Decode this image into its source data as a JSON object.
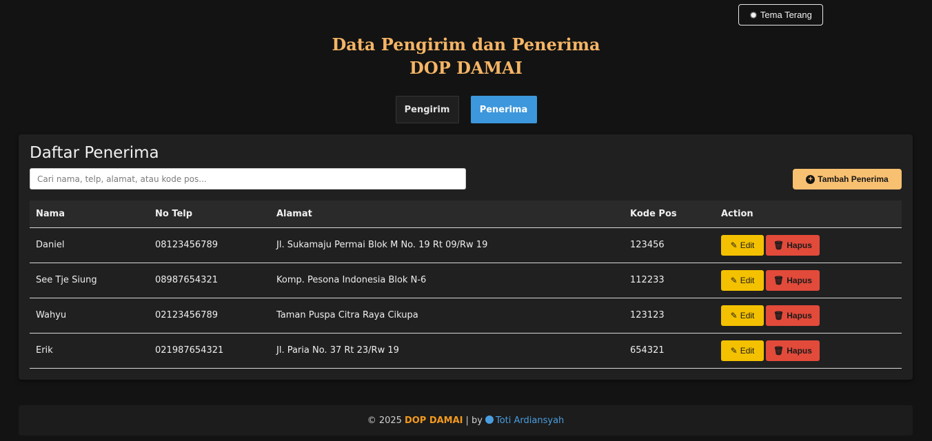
{
  "theme_toggle": {
    "label": "Tema Terang",
    "icon": "gear-icon"
  },
  "header": {
    "title_line1": "Data Pengirim dan Penerima",
    "title_line2": "DOP DAMAI"
  },
  "tabs": [
    {
      "label": "Pengirim",
      "active": false
    },
    {
      "label": "Penerima",
      "active": true
    }
  ],
  "card": {
    "title": "Daftar Penerima",
    "search_placeholder": "Cari nama, telp, alamat, atau kode pos...",
    "add_button": "Tambah Penerima"
  },
  "table": {
    "headers": [
      "Nama",
      "No Telp",
      "Alamat",
      "Kode Pos",
      "Action"
    ],
    "rows": [
      {
        "nama": "Daniel",
        "telp": "08123456789",
        "alamat": "Jl. Sukamaju Permai Blok M No. 19 Rt 09/Rw 19",
        "kode_pos": "123456"
      },
      {
        "nama": "See Tje Siung",
        "telp": "08987654321",
        "alamat": "Komp. Pesona Indonesia Blok N-6",
        "kode_pos": "112233"
      },
      {
        "nama": "Wahyu",
        "telp": "02123456789",
        "alamat": "Taman Puspa Citra Raya Cikupa",
        "kode_pos": "123123"
      },
      {
        "nama": "Erik",
        "telp": "021987654321",
        "alamat": "Jl. Paria No. 37 Rt 23/Rw 19",
        "kode_pos": "654321"
      }
    ],
    "edit_label": "Edit",
    "delete_label": "Hapus"
  },
  "footer": {
    "copyright": "© 2025",
    "brand": "DOP DAMAI",
    "separator": "| by",
    "author": "Toti Ardiansyah"
  },
  "colors": {
    "background": "#131313",
    "title": "#f5b566",
    "active_tab": "#3d97dc",
    "add_button": "#f8c071",
    "edit_button": "#f4c100",
    "delete_button": "#e24a3a",
    "footer_brand": "#f39a1e",
    "footer_link": "#4a9ee0"
  }
}
